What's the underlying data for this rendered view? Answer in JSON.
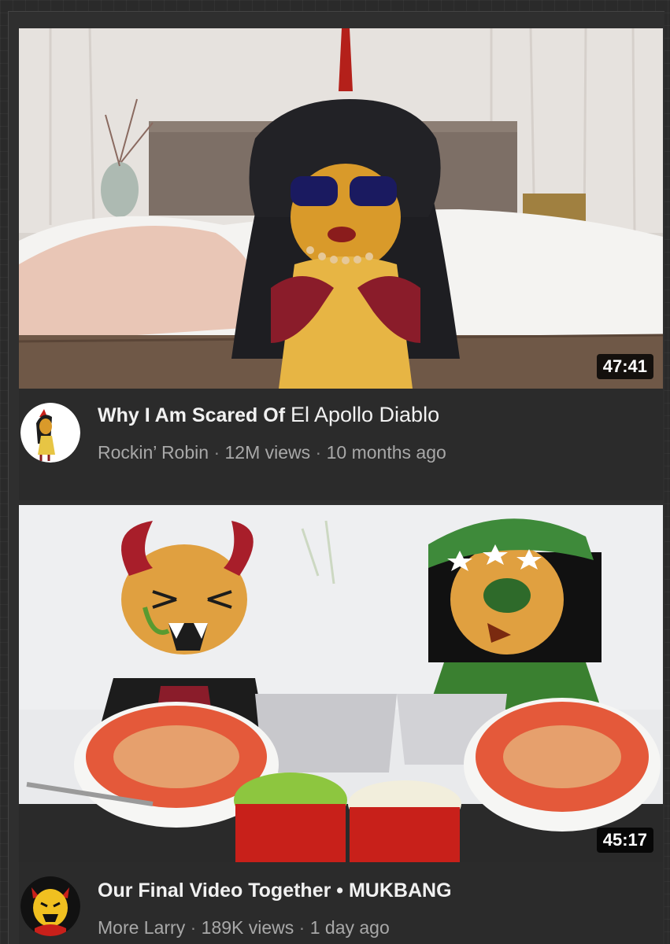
{
  "videos": [
    {
      "duration": "47:41",
      "title_main": "Why I Am Scared Of",
      "title_extra": "El Apollo Diablo",
      "channel": "Rockin’ Robin",
      "views": "12M views",
      "age": "10 months ago",
      "separator": "·"
    },
    {
      "duration": "45:17",
      "title_main": "Our Final Video Together • MUKBANG",
      "channel_prefix": "More",
      "channel": "Larry",
      "views": "189K views",
      "age": "1 day ago",
      "separator": "·"
    }
  ],
  "colors": {
    "background": "#2a2a2a",
    "card": "#2b2b2b",
    "title": "#f1f1f1",
    "meta": "#a8a8a8",
    "duration_bg": "#000000"
  },
  "icons": {
    "avatar_1": "chicken-character-avatar",
    "avatar_2": "yellow-devil-character-avatar"
  }
}
